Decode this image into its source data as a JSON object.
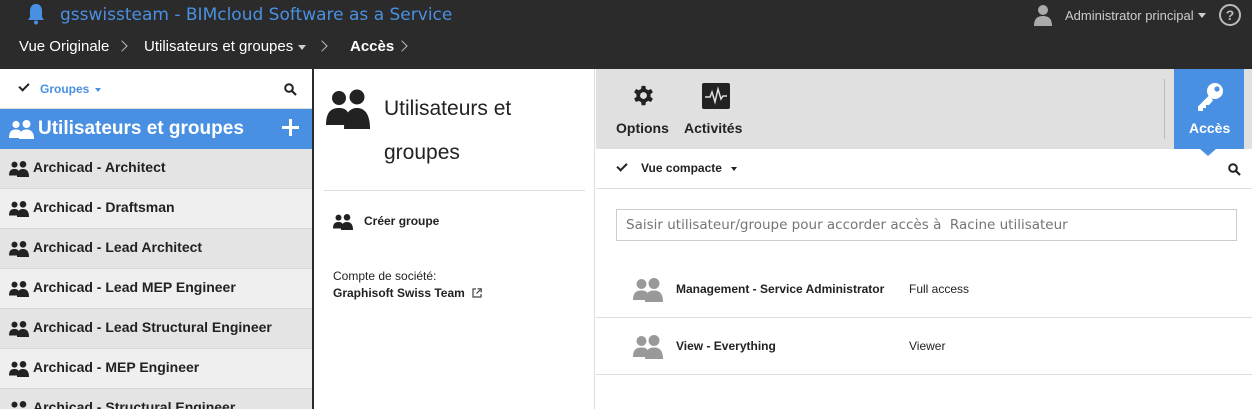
{
  "header": {
    "app_title": "gsswissteam - BIMcloud Software as a Service",
    "user_name": "Administrator principal",
    "help": "?"
  },
  "breadcrumb": [
    {
      "label": "Vue Originale"
    },
    {
      "label": "Utilisateurs et groupes"
    },
    {
      "label": "Accès"
    }
  ],
  "sidebar": {
    "filter_label": "Groupes",
    "section_title": "Utilisateurs et groupes",
    "groups": [
      "Archicad - Architect",
      "Archicad - Draftsman",
      "Archicad - Lead Architect",
      "Archicad - Lead MEP Engineer",
      "Archicad - Lead Structural Engineer",
      "Archicad - MEP Engineer",
      "Archicad - Structural Engineer"
    ]
  },
  "detail": {
    "title": "Utilisateurs et groupes",
    "create_group": "Créer groupe",
    "company_label": "Compte de société:",
    "company_name": "Graphisoft Swiss Team"
  },
  "toolbar": {
    "options": "Options",
    "activities": "Activités",
    "access": "Accès"
  },
  "access": {
    "view_mode": "Vue compacte",
    "grant_placeholder": "Saisir utilisateur/groupe pour accorder accès à  Racine utilisateur",
    "entries": [
      {
        "name": "Management - Service Administrator",
        "level": "Full access"
      },
      {
        "name": "View - Everything",
        "level": "Viewer"
      }
    ]
  },
  "colors": {
    "accent": "#4a90e2",
    "topbar": "#2b2b2b"
  }
}
